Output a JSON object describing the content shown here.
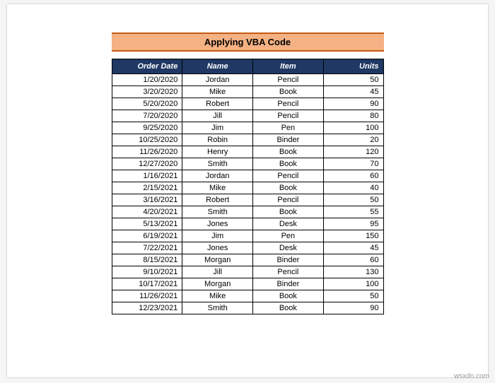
{
  "title": "Applying VBA Code",
  "columns": [
    "Order Date",
    "Name",
    "Item",
    "Units"
  ],
  "rows": [
    {
      "date": "1/20/2020",
      "name": "Jordan",
      "item": "Pencil",
      "units": "50"
    },
    {
      "date": "3/20/2020",
      "name": "Mike",
      "item": "Book",
      "units": "45"
    },
    {
      "date": "5/20/2020",
      "name": "Robert",
      "item": "Pencil",
      "units": "90"
    },
    {
      "date": "7/20/2020",
      "name": "Jill",
      "item": "Pencil",
      "units": "80"
    },
    {
      "date": "9/25/2020",
      "name": "Jim",
      "item": "Pen",
      "units": "100"
    },
    {
      "date": "10/25/2020",
      "name": "Robin",
      "item": "Binder",
      "units": "20"
    },
    {
      "date": "11/26/2020",
      "name": "Henry",
      "item": "Book",
      "units": "120"
    },
    {
      "date": "12/27/2020",
      "name": "Smith",
      "item": "Book",
      "units": "70"
    },
    {
      "date": "1/16/2021",
      "name": "Jordan",
      "item": "Pencil",
      "units": "60"
    },
    {
      "date": "2/15/2021",
      "name": "Mike",
      "item": "Book",
      "units": "40"
    },
    {
      "date": "3/16/2021",
      "name": "Robert",
      "item": "Pencil",
      "units": "50"
    },
    {
      "date": "4/20/2021",
      "name": "Smith",
      "item": "Book",
      "units": "55"
    },
    {
      "date": "5/13/2021",
      "name": "Jones",
      "item": "Desk",
      "units": "95"
    },
    {
      "date": "6/19/2021",
      "name": "Jim",
      "item": "Pen",
      "units": "150"
    },
    {
      "date": "7/22/2021",
      "name": "Jones",
      "item": "Desk",
      "units": "45"
    },
    {
      "date": "8/15/2021",
      "name": "Morgan",
      "item": "Binder",
      "units": "60"
    },
    {
      "date": "9/10/2021",
      "name": "Jill",
      "item": "Pencil",
      "units": "130"
    },
    {
      "date": "10/17/2021",
      "name": "Morgan",
      "item": "Binder",
      "units": "100"
    },
    {
      "date": "11/26/2021",
      "name": "Mike",
      "item": "Book",
      "units": "50"
    },
    {
      "date": "12/23/2021",
      "name": "Smith",
      "item": "Book",
      "units": "90"
    }
  ],
  "watermark": "wsxdn.com"
}
